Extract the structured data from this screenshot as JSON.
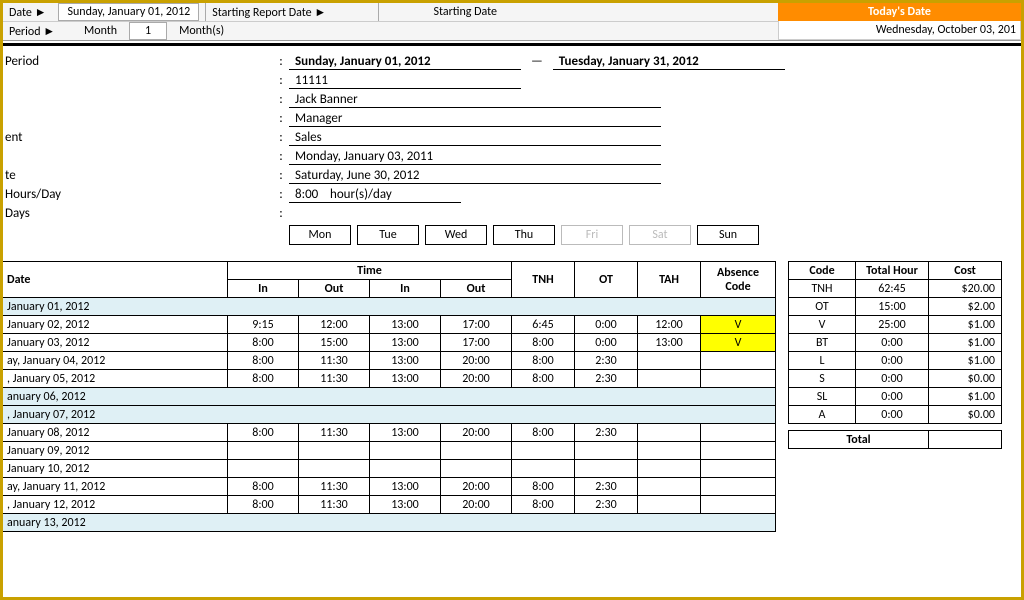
{
  "top": {
    "dateLabel": "Date ►",
    "dateValue": "Sunday, January 01, 2012",
    "startReportLabel": "Starting Report Date ►",
    "startDateLabel": "Starting Date",
    "periodLabel": "Period ►",
    "monthLabel": "Month",
    "monthValue": "1",
    "monthsLabel": "Month(s)",
    "todayHeader": "Today's Date",
    "todayValue": "Wednesday, October 03, 201"
  },
  "info": {
    "periodLabel": "Period",
    "periodFrom": "Sunday, January 01, 2012",
    "periodDash": "—",
    "periodTo": "Tuesday, January 31, 2012",
    "idValue": "11111",
    "nameValue": "Jack Banner",
    "titleValue": "Manager",
    "deptLabel": "ent",
    "deptValue": "Sales",
    "hireValue": "Monday, January 03, 2011",
    "endLabel": "te",
    "endValue": "Saturday, June 30, 2012",
    "hoursLabel": "Hours/Day",
    "hoursValue": "8:00    hour(s)/day",
    "daysLabel": "Days",
    "days": [
      "Mon",
      "Tue",
      "Wed",
      "Thu",
      "Fri",
      "Sat",
      "Sun"
    ],
    "dayoff": [
      false,
      false,
      false,
      false,
      true,
      true,
      false
    ]
  },
  "headers": {
    "date": "Date",
    "time": "Time",
    "in": "In",
    "out": "Out",
    "tnh": "TNH",
    "ot": "OT",
    "tah": "TAH",
    "ac": "Absence Code",
    "code": "Code",
    "th": "Total Hour",
    "cost": "Cost",
    "total": "Total"
  },
  "rows": [
    {
      "section": true,
      "date": "January 01, 2012"
    },
    {
      "date": "January 02, 2012",
      "in1": "9:15",
      "out1": "12:00",
      "in2": "13:00",
      "out2": "17:00",
      "tnh": "6:45",
      "ot": "0:00",
      "tah": "12:00",
      "ac": "V",
      "hl": true
    },
    {
      "date": "January 03, 2012",
      "in1": "8:00",
      "out1": "15:00",
      "in2": "13:00",
      "out2": "17:00",
      "tnh": "8:00",
      "ot": "0:00",
      "tah": "13:00",
      "ac": "V",
      "hl": true
    },
    {
      "date": "ay, January 04, 2012",
      "in1": "8:00",
      "out1": "11:30",
      "in2": "13:00",
      "out2": "20:00",
      "tnh": "8:00",
      "ot": "2:30",
      "tah": "",
      "ac": ""
    },
    {
      "date": ", January 05, 2012",
      "in1": "8:00",
      "out1": "11:30",
      "in2": "13:00",
      "out2": "20:00",
      "tnh": "8:00",
      "ot": "2:30",
      "tah": "",
      "ac": ""
    },
    {
      "section": true,
      "date": "anuary 06, 2012"
    },
    {
      "section": true,
      "date": ", January 07, 2012"
    },
    {
      "date": "January 08, 2012",
      "in1": "8:00",
      "out1": "11:30",
      "in2": "13:00",
      "out2": "20:00",
      "tnh": "8:00",
      "ot": "2:30",
      "tah": "",
      "ac": ""
    },
    {
      "date": "January 09, 2012",
      "in1": "",
      "out1": "",
      "in2": "",
      "out2": "",
      "tnh": "",
      "ot": "",
      "tah": "",
      "ac": ""
    },
    {
      "date": "January 10, 2012",
      "in1": "",
      "out1": "",
      "in2": "",
      "out2": "",
      "tnh": "",
      "ot": "",
      "tah": "",
      "ac": ""
    },
    {
      "date": "ay, January 11, 2012",
      "in1": "8:00",
      "out1": "11:30",
      "in2": "13:00",
      "out2": "20:00",
      "tnh": "8:00",
      "ot": "2:30",
      "tah": "",
      "ac": ""
    },
    {
      "date": ", January 12, 2012",
      "in1": "8:00",
      "out1": "11:30",
      "in2": "13:00",
      "out2": "20:00",
      "tnh": "8:00",
      "ot": "2:30",
      "tah": "",
      "ac": ""
    },
    {
      "section": true,
      "date": "anuary 13, 2012"
    }
  ],
  "summary": [
    {
      "code": "TNH",
      "hour": "62:45",
      "cost": "$20.00"
    },
    {
      "code": "OT",
      "hour": "15:00",
      "cost": "$2.00"
    },
    {
      "code": "V",
      "hour": "25:00",
      "cost": "$1.00"
    },
    {
      "code": "BT",
      "hour": "0:00",
      "cost": "$1.00"
    },
    {
      "code": "L",
      "hour": "0:00",
      "cost": "$1.00"
    },
    {
      "code": "S",
      "hour": "0:00",
      "cost": "$0.00"
    },
    {
      "code": "SL",
      "hour": "0:00",
      "cost": "$1.00"
    },
    {
      "code": "A",
      "hour": "0:00",
      "cost": "$0.00"
    }
  ]
}
